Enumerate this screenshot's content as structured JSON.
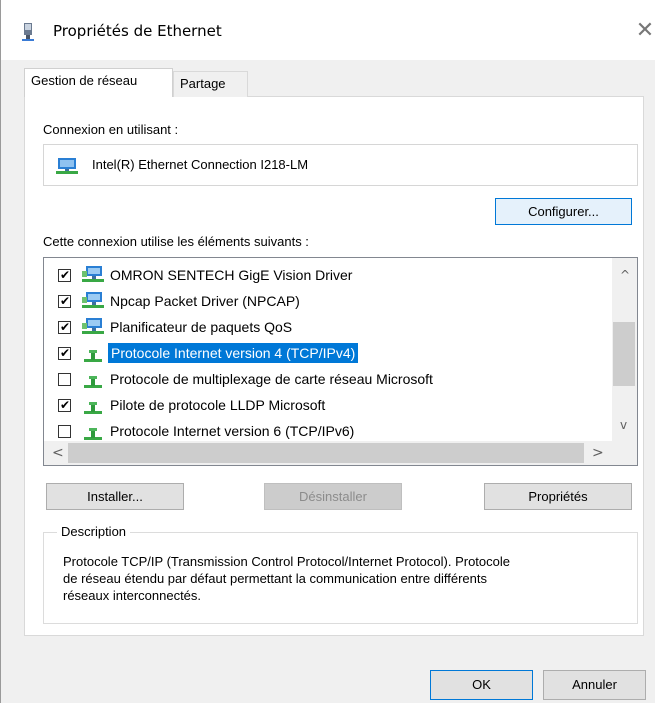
{
  "window": {
    "title": "Propriétés de Ethernet",
    "close_glyph": "✕"
  },
  "tabs": [
    {
      "label": "Gestion de réseau",
      "active": true
    },
    {
      "label": "Partage",
      "active": false
    }
  ],
  "connection": {
    "label": "Connexion en utilisant :",
    "adapter": "Intel(R) Ethernet Connection I218-LM",
    "configure_button": "Configurer..."
  },
  "components": {
    "label": "Cette connexion utilise les éléments suivants :",
    "items": [
      {
        "label": "OMRON SENTECH GigE Vision Driver",
        "checked": true,
        "icon": "network-service-icon",
        "selected": false
      },
      {
        "label": "Npcap Packet Driver (NPCAP)",
        "checked": true,
        "icon": "network-service-icon",
        "selected": false
      },
      {
        "label": "Planificateur de paquets QoS",
        "checked": true,
        "icon": "network-service-icon",
        "selected": false
      },
      {
        "label": "Protocole Internet version 4 (TCP/IPv4)",
        "checked": true,
        "icon": "protocol-icon",
        "selected": true
      },
      {
        "label": "Protocole de multiplexage de carte réseau Microsoft",
        "checked": false,
        "icon": "protocol-icon",
        "selected": false
      },
      {
        "label": "Pilote de protocole LLDP Microsoft",
        "checked": true,
        "icon": "protocol-icon",
        "selected": false
      },
      {
        "label": "Protocole Internet version 6 (TCP/IPv6)",
        "checked": false,
        "icon": "protocol-icon",
        "selected": false
      }
    ]
  },
  "actions": {
    "install": "Installer...",
    "uninstall": "Désinstaller",
    "properties": "Propriétés"
  },
  "description": {
    "legend": "Description",
    "line1": "Protocole TCP/IP (Transmission Control Protocol/Internet Protocol). Protocole",
    "line2": "de réseau étendu par défaut permettant la communication entre différents",
    "line3": "réseaux interconnectés."
  },
  "footer": {
    "ok": "OK",
    "cancel": "Annuler"
  },
  "colors": {
    "selection": "#0078d7",
    "window_bg": "#f0f0f0"
  }
}
